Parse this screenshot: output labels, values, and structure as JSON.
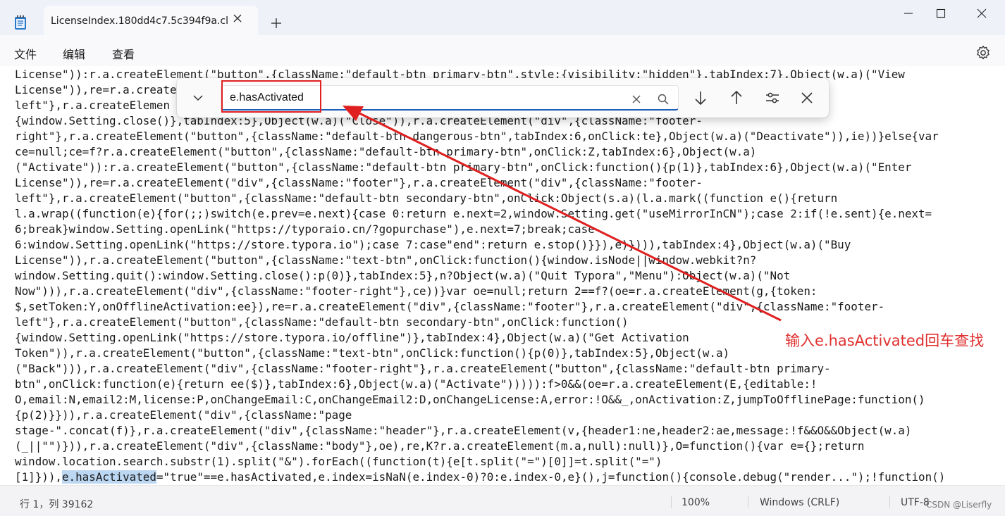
{
  "window": {
    "tab_title": "LicenseIndex.180dd4c7.5c394f9a.cl",
    "new_tab_symbol": "+"
  },
  "menu": {
    "items": [
      "文件",
      "编辑",
      "查看"
    ]
  },
  "find": {
    "query": "e.hasActivated"
  },
  "code": {
    "lines": [
      "License\")):r.a.createElement(\"button\",{className:\"default-btn primary-btn\",style:{visibility:\"hidden\"},tabIndex:7},Object(w.a)(\"View",
      "License\")),re=r.a.create",
      "left\"},r.a.createElemen",
      "{window.Setting.close()},tabIndex:5},Object(w.a)(\"Close\")),r.a.createElement(\"div\",{className:\"footer-",
      "right\"},r.a.createElement(\"button\",{className:\"default-btn dangerous-btn\",tabIndex:6,onClick:te},Object(w.a)(\"Deactivate\")),ie))}else{var",
      "ce=null;ce=f?r.a.createElement(\"button\",{className:\"default-btn primary-btn\",onClick:Z,tabIndex:6},Object(w.a)",
      "(\"Activate\")):r.a.createElement(\"button\",{className:\"default-btn primary-btn\",onClick:function(){p(1)},tabIndex:6},Object(w.a)(\"Enter",
      "License\")),re=r.a.createElement(\"div\",{className:\"footer\"},r.a.createElement(\"div\",{className:\"footer-",
      "left\"},r.a.createElement(\"button\",{className:\"default-btn secondary-btn\",onClick:Object(s.a)(l.a.mark((function e(){return",
      "l.a.wrap((function(e){for(;;)switch(e.prev=e.next){case 0:return e.next=2,window.Setting.get(\"useMirrorInCN\");case 2:if(!e.sent){e.next=",
      "6;break}window.Setting.openLink(\"https://typoraio.cn/?gopurchase\"),e.next=7;break;case",
      "6:window.Setting.openLink(\"https://store.typora.io\");case 7:case\"end\":return e.stop()}}),e)}))),tabIndex:4},Object(w.a)(\"Buy",
      "License\")),r.a.createElement(\"button\",{className:\"text-btn\",onClick:function(){window.isNode||window.webkit?n?",
      "window.Setting.quit():window.Setting.close():p(0)},tabIndex:5},n?Object(w.a)(\"Quit Typora\",\"Menu\"):Object(w.a)(\"Not",
      "Now\"))),r.a.createElement(\"div\",{className:\"footer-right\"},ce))}var oe=null;return 2==f?(oe=r.a.createElement(g,{token:",
      "$,setToken:Y,onOfflineActivation:ee}),re=r.a.createElement(\"div\",{className:\"footer\"},r.a.createElement(\"div\",{className:\"footer-",
      "left\"},r.a.createElement(\"button\",{className:\"default-btn secondary-btn\",onClick:function()",
      "{window.Setting.openLink(\"https://store.typora.io/offline\")},tabIndex:4},Object(w.a)(\"Get Activation",
      "Token\")),r.a.createElement(\"button\",{className:\"text-btn\",onClick:function(){p(0)},tabIndex:5},Object(w.a)",
      "(\"Back\"))),r.a.createElement(\"div\",{className:\"footer-right\"},r.a.createElement(\"button\",{className:\"default-btn primary-",
      "btn\",onClick:function(e){return ee($)},tabIndex:6},Object(w.a)(\"Activate\"))))):f>0&&(oe=r.a.createElement(E,{editable:!",
      "O,email:N,email2:M,license:P,onChangeEmail:C,onChangeEmail2:D,onChangeLicense:A,error:!O&&_,onActivation:Z,jumpToOfflinePage:function()",
      "{p(2)}})),r.a.createElement(\"div\",{className:\"page",
      "stage-\".concat(f)},r.a.createElement(\"div\",{className:\"header\"},r.a.createElement(v,{header1:ne,header2:ae,message:!f&&O&&Object(w.a)",
      "(_||\"\")})),r.a.createElement(\"div\",{className:\"body\"},oe),re,K?r.a.createElement(m.a,null):null)},O=function(){var e={};return",
      "window.location.search.substr(1).split(\"&\").forEach((function(t){e[t.split(\"=\")[0]]=t.split(\"=\")"
    ],
    "last_line_before": "[1]})),",
    "last_line_match": "e.hasActivated",
    "last_line_after": "=\"true\"==e.hasActivated,e.index=isNaN(e.index-0)?0:e.index-0,e}(),j=function(){console.debug(\"render...\");!function()"
  },
  "annotation": {
    "text": "输入e.hasActivated回车查找"
  },
  "status": {
    "position": "行 1，列 39162",
    "zoom": "100%",
    "line_ending": "Windows (CRLF)",
    "encoding": "UTF-8",
    "watermark": "CSDN @Liserfly"
  },
  "colors": {
    "accent": "#1d5fb8",
    "annotation_red": "#e03030",
    "match_highlight": "#bcd7f2"
  }
}
